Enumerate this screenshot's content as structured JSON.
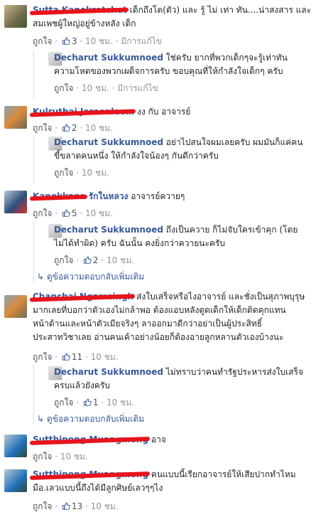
{
  "comments": [
    {
      "name": "Sutta Kanokratchut",
      "text_line1": "เด็กถึงโต(ตัว) และ รู้ ไม่ เท่า ทัน....น่าสงสาร และ",
      "text_line2": "สมเพชผู้ใหญ่อยู่ข้างหลัง เด็ก",
      "like_label": "ถูกใจ",
      "likes": "3",
      "time": "10 ชม.",
      "edited": "มีการแก้ไข",
      "reply": {
        "name": "Decharut Sukkumnoed",
        "text_line1": "ใช่ครับ ยากที่พวกเด็กๆจะรู้เท่าทัน",
        "text_line2": "ความโหดของพวกเผด็จการครับ ขอบคุณที่ให้กำลังใจเด็กๆ ครับ",
        "like_label": "ถูกใจ",
        "time": "10 ชม.",
        "edited": "มีการแก้ไข"
      }
    },
    {
      "name": "Kulruthai Jaroenlaem",
      "text_line1": "งง กับ อาจารย์",
      "like_label": "ถูกใจ",
      "likes": "2",
      "time": "10 ชม.",
      "reply": {
        "name": "Decharut Sukkumnoed",
        "text_line1": "อย่าไปสนใจผมเลยครับ ผมมันก็แค่คน",
        "text_line2": "ขี้ขลาดคนหนึ่ง ให้กำลังใจน้องๆ กันดีกว่าครับ",
        "like_label": "ถูกใจ",
        "time": "10 ชม."
      }
    },
    {
      "name": "Kanokkana",
      "name_suffix": "รักในหลวง",
      "text_line1": "อาจารย์ควายๆ",
      "like_label": "ถูกใจ",
      "likes": "5",
      "time": "10 ชม.",
      "reply": {
        "name": "Decharut Sukkumnoed",
        "text_line1": "ถึงเป็นควาย ก็ไม่จับใครเข้าคุก (โดย",
        "text_line2": "ไม่ได้ทำผิด) ครับ ฉันนั้น คงยิ่งกว่าควายนะครับ",
        "like_label": "ถูกใจ",
        "likes": "2",
        "time": "10 ชม."
      },
      "more_replies": "ดูข้อความตอบกลับเพิ่มเติม"
    },
    {
      "name": "Chanchai Ngamsingh",
      "text_line1": "ส่งใบเสร็จหรือไงอาจารย์ และชั่งเป็นสุภาพบุรุษ",
      "text_line2": "มากเลยที่บอกว่าตัวเองไม่กล้าพอ ต้องแอบหลังตูดเด็กให้เด็กติดคุกแทน",
      "text_line3": "หน้าด้านและหน้าตัวเมียจริงๆ ลาออกมาดีกว่าอย่าเป็นผู้ประสิทธิ์",
      "text_line4": "ประสาทวิชาเลย อ่านคนเค้าอย่างน้อยก็ต้องอายลูกหลานตัวเองบ้างนะ",
      "like_label": "ถูกใจ",
      "likes": "11",
      "time": "10 ชม.",
      "reply": {
        "name": "Decharut Sukkumnoed",
        "text_line1": "ไม่ทราบว่าคนทำรัฐประหารส่งใบเสร็จ",
        "text_line2": "ครบแล้วยังครับ",
        "like_label": "ถูกใจ",
        "likes": "1",
        "time": "10 ชม."
      },
      "more_replies": "ดูข้อความตอบกลับเพิ่มเติม"
    },
    {
      "name": "Sutthipong Muangmong",
      "text_line1": "อาจ",
      "like_label": "ถูกใจ",
      "time": "10 ชม."
    },
    {
      "name": "Sutthipong Muangmong",
      "text_line1": "คนแบบนี้เรียกอาจารย์ให้เสียปากทำไหม",
      "text_line2": "มือ.เลวแบบนี้ถึงได้มีลูกศิษย์เลวๆๆไง",
      "like_label": "ถูกใจ",
      "likes": "13",
      "time": "10 ชม."
    }
  ],
  "colors": {
    "link": "#365899",
    "meta": "#90949c",
    "redaction": "#e8141c"
  },
  "icons": {
    "like": "thumbs-up-icon",
    "reply_arrow": "reply-arrow-icon"
  }
}
